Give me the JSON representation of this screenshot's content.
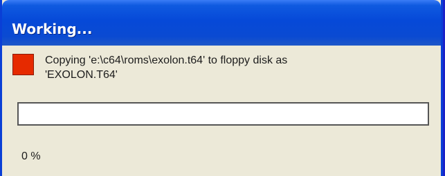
{
  "window": {
    "title": "Working..."
  },
  "status": {
    "icon": "red-square-icon",
    "message_line1": "Copying 'e:\\c64\\roms\\exolon.t64' to floppy disk as",
    "message_line2": "'EXOLON.T64'"
  },
  "progress": {
    "value": 0,
    "percent_label": "0 %"
  },
  "colors": {
    "titlebar": "#0649d8",
    "client_bg": "#ece9d8",
    "icon": "#e62a00"
  }
}
